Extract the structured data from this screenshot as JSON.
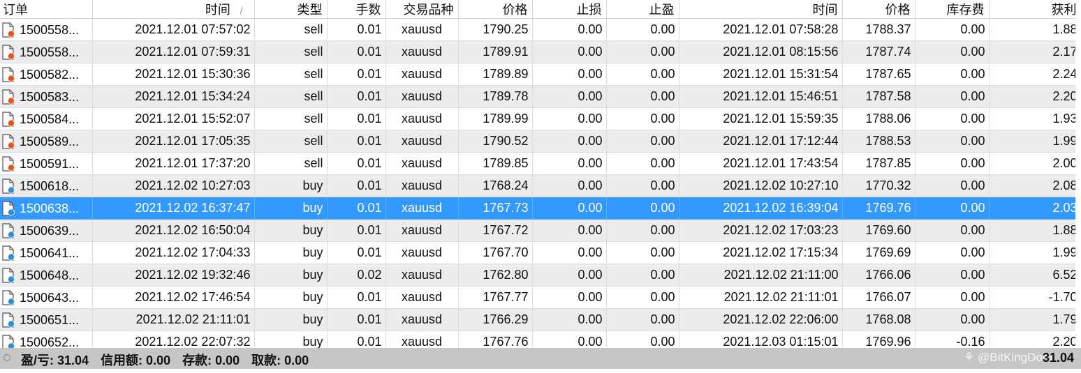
{
  "columns": [
    "订单",
    "时间",
    "类型",
    "手数",
    "交易品种",
    "价格",
    "止损",
    "止盈",
    "时间",
    "价格",
    "库存费",
    "获利"
  ],
  "sort_indicator": "/",
  "rows": [
    {
      "order": "1500558...",
      "open_time": "2021.12.01 07:57:02",
      "type": "sell",
      "volume": "0.01",
      "symbol": "xauusd",
      "open_price": "1790.25",
      "sl": "0.00",
      "tp": "0.00",
      "close_time": "2021.12.01 07:58:28",
      "close_price": "1788.37",
      "swap": "0.00",
      "profit": "1.88"
    },
    {
      "order": "1500558...",
      "open_time": "2021.12.01 07:59:31",
      "type": "sell",
      "volume": "0.01",
      "symbol": "xauusd",
      "open_price": "1789.91",
      "sl": "0.00",
      "tp": "0.00",
      "close_time": "2021.12.01 08:15:56",
      "close_price": "1787.74",
      "swap": "0.00",
      "profit": "2.17"
    },
    {
      "order": "1500582...",
      "open_time": "2021.12.01 15:30:36",
      "type": "sell",
      "volume": "0.01",
      "symbol": "xauusd",
      "open_price": "1789.89",
      "sl": "0.00",
      "tp": "0.00",
      "close_time": "2021.12.01 15:31:54",
      "close_price": "1787.65",
      "swap": "0.00",
      "profit": "2.24"
    },
    {
      "order": "1500583...",
      "open_time": "2021.12.01 15:34:24",
      "type": "sell",
      "volume": "0.01",
      "symbol": "xauusd",
      "open_price": "1789.78",
      "sl": "0.00",
      "tp": "0.00",
      "close_time": "2021.12.01 15:46:51",
      "close_price": "1787.58",
      "swap": "0.00",
      "profit": "2.20"
    },
    {
      "order": "1500584...",
      "open_time": "2021.12.01 15:52:07",
      "type": "sell",
      "volume": "0.01",
      "symbol": "xauusd",
      "open_price": "1789.99",
      "sl": "0.00",
      "tp": "0.00",
      "close_time": "2021.12.01 15:59:35",
      "close_price": "1788.06",
      "swap": "0.00",
      "profit": "1.93"
    },
    {
      "order": "1500589...",
      "open_time": "2021.12.01 17:05:35",
      "type": "sell",
      "volume": "0.01",
      "symbol": "xauusd",
      "open_price": "1790.52",
      "sl": "0.00",
      "tp": "0.00",
      "close_time": "2021.12.01 17:12:44",
      "close_price": "1788.53",
      "swap": "0.00",
      "profit": "1.99"
    },
    {
      "order": "1500591...",
      "open_time": "2021.12.01 17:37:20",
      "type": "sell",
      "volume": "0.01",
      "symbol": "xauusd",
      "open_price": "1789.85",
      "sl": "0.00",
      "tp": "0.00",
      "close_time": "2021.12.01 17:43:54",
      "close_price": "1787.85",
      "swap": "0.00",
      "profit": "2.00"
    },
    {
      "order": "1500618...",
      "open_time": "2021.12.02 10:27:03",
      "type": "buy",
      "volume": "0.01",
      "symbol": "xauusd",
      "open_price": "1768.24",
      "sl": "0.00",
      "tp": "0.00",
      "close_time": "2021.12.02 10:27:10",
      "close_price": "1770.32",
      "swap": "0.00",
      "profit": "2.08"
    },
    {
      "order": "1500638...",
      "open_time": "2021.12.02 16:37:47",
      "type": "buy",
      "volume": "0.01",
      "symbol": "xauusd",
      "open_price": "1767.73",
      "sl": "0.00",
      "tp": "0.00",
      "close_time": "2021.12.02 16:39:04",
      "close_price": "1769.76",
      "swap": "0.00",
      "profit": "2.03",
      "selected": true
    },
    {
      "order": "1500639...",
      "open_time": "2021.12.02 16:50:04",
      "type": "buy",
      "volume": "0.01",
      "symbol": "xauusd",
      "open_price": "1767.72",
      "sl": "0.00",
      "tp": "0.00",
      "close_time": "2021.12.02 17:03:23",
      "close_price": "1769.60",
      "swap": "0.00",
      "profit": "1.88"
    },
    {
      "order": "1500641...",
      "open_time": "2021.12.02 17:04:33",
      "type": "buy",
      "volume": "0.01",
      "symbol": "xauusd",
      "open_price": "1767.70",
      "sl": "0.00",
      "tp": "0.00",
      "close_time": "2021.12.02 17:15:34",
      "close_price": "1769.69",
      "swap": "0.00",
      "profit": "1.99"
    },
    {
      "order": "1500648...",
      "open_time": "2021.12.02 19:32:46",
      "type": "buy",
      "volume": "0.02",
      "symbol": "xauusd",
      "open_price": "1762.80",
      "sl": "0.00",
      "tp": "0.00",
      "close_time": "2021.12.02 21:11:00",
      "close_price": "1766.06",
      "swap": "0.00",
      "profit": "6.52"
    },
    {
      "order": "1500643...",
      "open_time": "2021.12.02 17:46:54",
      "type": "buy",
      "volume": "0.01",
      "symbol": "xauusd",
      "open_price": "1767.77",
      "sl": "0.00",
      "tp": "0.00",
      "close_time": "2021.12.02 21:11:01",
      "close_price": "1766.07",
      "swap": "0.00",
      "profit": "-1.70"
    },
    {
      "order": "1500651...",
      "open_time": "2021.12.02 21:11:01",
      "type": "buy",
      "volume": "0.01",
      "symbol": "xauusd",
      "open_price": "1766.29",
      "sl": "0.00",
      "tp": "0.00",
      "close_time": "2021.12.02 22:06:00",
      "close_price": "1768.08",
      "swap": "0.00",
      "profit": "1.79"
    },
    {
      "order": "1500652...",
      "open_time": "2021.12.02 22:07:32",
      "type": "buy",
      "volume": "0.01",
      "symbol": "xauusd",
      "open_price": "1767.76",
      "sl": "0.00",
      "tp": "0.00",
      "close_time": "2021.12.03 01:15:01",
      "close_price": "1769.96",
      "swap": "-0.16",
      "profit": "2.20"
    }
  ],
  "footer": {
    "pl": "盈/亏: 31.04",
    "credit": "信用额: 0.00",
    "deposit": "存款: 0.00",
    "withdrawal": "取款: 0.00",
    "watermark": "@BitKingDom",
    "total": "31.04"
  },
  "icons": {
    "sell": "order-doc-icon-red",
    "buy": "order-doc-icon-blue",
    "status": "status-circle-icon"
  },
  "colors": {
    "sell_badge": "#e8531f",
    "buy_badge": "#2f8fd8",
    "selected_row": "#3399ff",
    "footer_bg": "#c6c6c6"
  }
}
